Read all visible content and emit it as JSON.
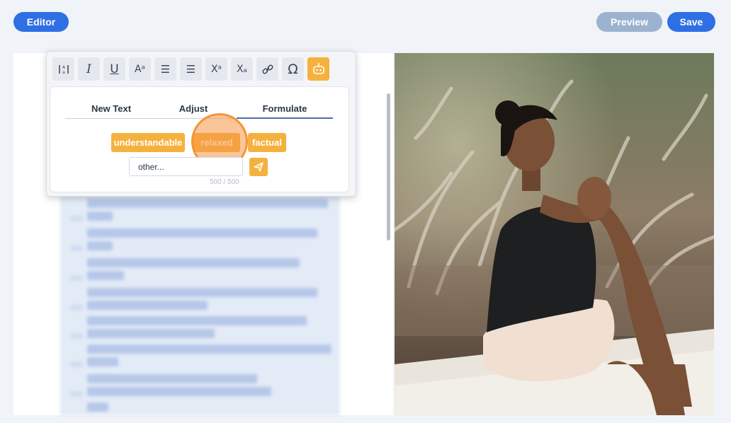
{
  "header": {
    "editor_label": "Editor",
    "preview_label": "Preview",
    "save_label": "Save"
  },
  "toolbar": {
    "buttons": [
      {
        "icon": "transform-icon",
        "glyph": ""
      },
      {
        "icon": "italic-icon",
        "glyph": "I"
      },
      {
        "icon": "underline-icon",
        "glyph": "U"
      },
      {
        "icon": "font-size-icon",
        "glyph": "Aᵃ"
      },
      {
        "icon": "ordered-list-icon",
        "glyph": "☰"
      },
      {
        "icon": "bullet-list-icon",
        "glyph": "☰"
      },
      {
        "icon": "superscript-icon",
        "glyph": "Xᵃ"
      },
      {
        "icon": "subscript-icon",
        "glyph": "Xₐ"
      },
      {
        "icon": "link-icon",
        "glyph": ""
      },
      {
        "icon": "special-character-icon",
        "glyph": "Ω"
      },
      {
        "icon": "ai-assistant-icon",
        "glyph": ""
      }
    ]
  },
  "ai_panel": {
    "tabs": [
      "New Text",
      "Adjust",
      "Formulate"
    ],
    "active_tab": "Formulate",
    "chips": [
      "understandable",
      "relaxed",
      "factual"
    ],
    "other_placeholder": "other...",
    "counter": "500 / 500"
  },
  "colors": {
    "primary": "#2f6fe4",
    "preview": "#9cb3cf",
    "accent": "#f5b13e"
  }
}
